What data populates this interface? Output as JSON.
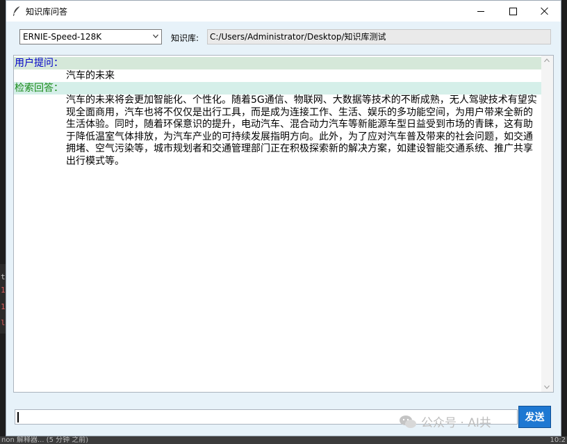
{
  "window": {
    "title": "知识库问答"
  },
  "toolbar": {
    "model_value": "ERNIE-Speed-128K",
    "kb_label": "知识库:",
    "kb_path": "C:/Users/Administrator/Desktop/知识库测试"
  },
  "chat": {
    "user_label": "用户提问：",
    "question": "汽车的未来",
    "answer_label": "检索回答：",
    "answer": "汽车的未来将会更加智能化、个性化。随着5G通信、物联网、大数据等技术的不断成熟，无人驾驶技术有望实现全面商用，汽车也将不仅仅是出行工具，而是成为连接工作、生活、娱乐的多功能空间，为用户带来全新的生活体验。同时，随着环保意识的提升，电动汽车、混合动力汽车等新能源车型日益受到市场的青睐，这有助于降低温室气体排放，为汽车产业的可持续发展指明方向。此外，为了应对汽车普及带来的社会问题，如交通拥堵、空气污染等，城市规划者和交通管理部门正在积极探索新的解决方案，如建设智能交通系统、推广共享出行模式等。"
  },
  "input": {
    "value": ""
  },
  "send_label": "发送",
  "watermark": "公众号 · AI共",
  "background": {
    "chars": [
      "t",
      "1",
      "1",
      "l"
    ],
    "status_left": "non 解释器... (5 分钟 之前)",
    "status_right": "10:2"
  },
  "colors": {
    "user_label": "#0000c8",
    "answer_label": "#188a18",
    "send_button": "#1e78d2",
    "window_bg": "#e7f2f9"
  },
  "icons": [
    "feather-icon",
    "minimize-icon",
    "maximize-icon",
    "close-icon",
    "chevron-down-icon",
    "wechat-icon"
  ]
}
